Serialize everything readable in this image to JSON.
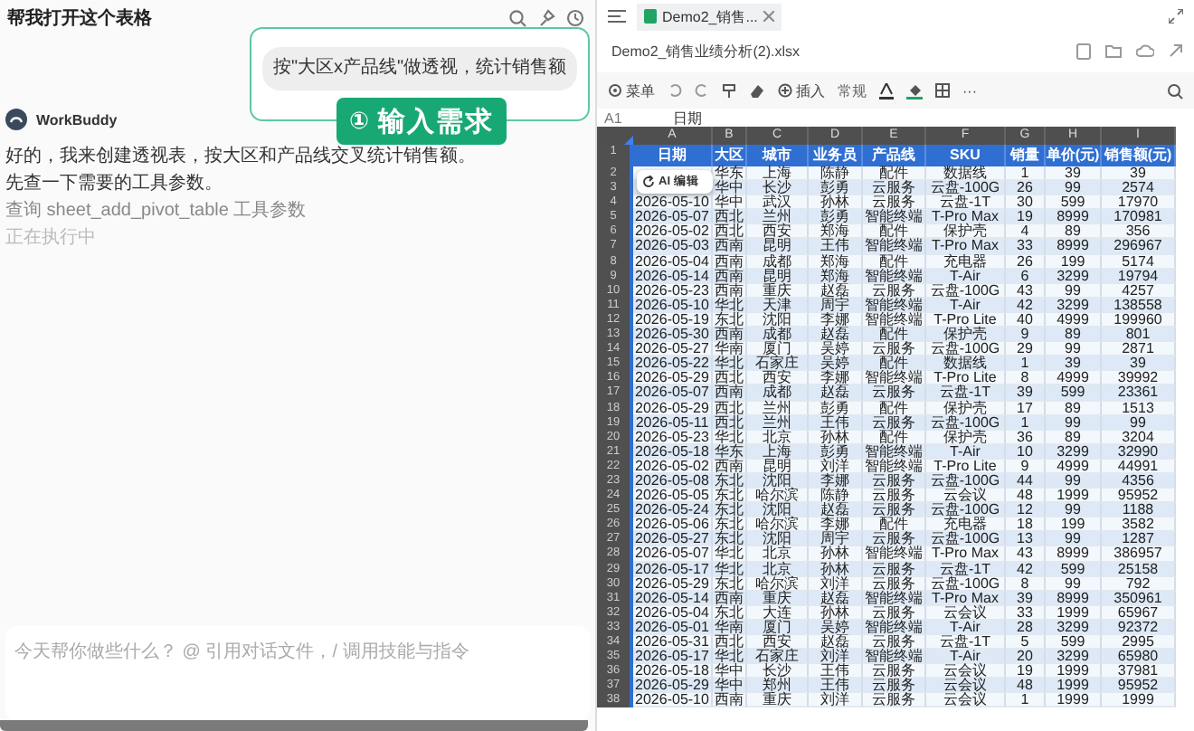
{
  "chat": {
    "title": "帮我打开这个表格",
    "callout": {
      "bubble": "按\"大区x产品线\"做透视，统计销售额",
      "badge": "①",
      "label": "输入需求"
    },
    "assistant": {
      "name": "WorkBuddy"
    },
    "messages": [
      {
        "kind": "text",
        "text": "好的，我来创建透视表，按大区和产品线交叉统计销售额。"
      },
      {
        "kind": "text",
        "text": "先查一下需要的工具参数。"
      },
      {
        "kind": "tool",
        "text": "查询 sheet_add_pivot_table 工具参数"
      },
      {
        "kind": "status",
        "text": "正在执行中"
      }
    ],
    "input": {
      "placeholder": "今天帮你做些什么？ @ 引用对话文件，/ 调用技能与指令"
    }
  },
  "spreadsheet": {
    "tab": {
      "label": "Demo2_销售...",
      "selected": true
    },
    "file_name": "Demo2_销售业绩分析(2).xlsx",
    "toolbar": {
      "menu": "菜单",
      "insert": "插入",
      "number_format": "常规",
      "more": "···"
    },
    "cell_ref": "A1",
    "formula": "日期",
    "overlay_button": "AI 编辑",
    "column_letters": [
      "A",
      "B",
      "C",
      "D",
      "E",
      "F",
      "G",
      "H",
      "I"
    ],
    "header_row": {
      "number": "1",
      "cells": [
        "日期",
        "大区",
        "城市",
        "业务员",
        "产品线",
        "SKU",
        "销量",
        "单价(元)",
        "销售额(元)"
      ]
    },
    "rows": [
      {
        "number": "2",
        "values": [
          "华东",
          "上海",
          "陈静",
          "配件",
          "数据线",
          "1",
          "39",
          "39"
        ]
      },
      {
        "number": "3",
        "values": [
          "华中",
          "长沙",
          "彭勇",
          "云服务",
          "云盘-100G",
          "26",
          "99",
          "2574"
        ]
      },
      {
        "number": "4",
        "date": "2026-05-10",
        "values": [
          "华中",
          "武汉",
          "孙林",
          "云服务",
          "云盘-1T",
          "30",
          "599",
          "17970"
        ]
      },
      {
        "number": "5",
        "date": "2026-05-07",
        "values": [
          "西北",
          "兰州",
          "彭勇",
          "智能终端",
          "T-Pro Max",
          "19",
          "8999",
          "170981"
        ]
      },
      {
        "number": "6",
        "date": "2026-05-02",
        "values": [
          "西北",
          "西安",
          "郑海",
          "配件",
          "保护壳",
          "4",
          "89",
          "356"
        ]
      },
      {
        "number": "7",
        "date": "2026-05-03",
        "values": [
          "西南",
          "昆明",
          "王伟",
          "智能终端",
          "T-Pro Max",
          "33",
          "8999",
          "296967"
        ]
      },
      {
        "number": "8",
        "date": "2026-05-04",
        "values": [
          "西南",
          "成都",
          "郑海",
          "配件",
          "充电器",
          "26",
          "199",
          "5174"
        ]
      },
      {
        "number": "9",
        "date": "2026-05-14",
        "values": [
          "西南",
          "昆明",
          "郑海",
          "智能终端",
          "T-Air",
          "6",
          "3299",
          "19794"
        ]
      },
      {
        "number": "10",
        "date": "2026-05-23",
        "values": [
          "西南",
          "重庆",
          "赵磊",
          "云服务",
          "云盘-100G",
          "43",
          "99",
          "4257"
        ]
      },
      {
        "number": "11",
        "date": "2026-05-10",
        "values": [
          "华北",
          "天津",
          "周宇",
          "智能终端",
          "T-Air",
          "42",
          "3299",
          "138558"
        ]
      },
      {
        "number": "12",
        "date": "2026-05-19",
        "values": [
          "东北",
          "沈阳",
          "李娜",
          "智能终端",
          "T-Pro Lite",
          "40",
          "4999",
          "199960"
        ]
      },
      {
        "number": "13",
        "date": "2026-05-30",
        "values": [
          "西南",
          "成都",
          "赵磊",
          "配件",
          "保护壳",
          "9",
          "89",
          "801"
        ]
      },
      {
        "number": "14",
        "date": "2026-05-27",
        "values": [
          "华南",
          "厦门",
          "吴婷",
          "云服务",
          "云盘-100G",
          "29",
          "99",
          "2871"
        ]
      },
      {
        "number": "15",
        "date": "2026-05-22",
        "values": [
          "华北",
          "石家庄",
          "吴婷",
          "配件",
          "数据线",
          "1",
          "39",
          "39"
        ]
      },
      {
        "number": "16",
        "date": "2026-05-29",
        "values": [
          "西北",
          "西安",
          "李娜",
          "智能终端",
          "T-Pro Lite",
          "8",
          "4999",
          "39992"
        ]
      },
      {
        "number": "17",
        "date": "2026-05-07",
        "values": [
          "西南",
          "成都",
          "赵磊",
          "云服务",
          "云盘-1T",
          "39",
          "599",
          "23361"
        ]
      },
      {
        "number": "18",
        "date": "2026-05-29",
        "values": [
          "西北",
          "兰州",
          "彭勇",
          "配件",
          "保护壳",
          "17",
          "89",
          "1513"
        ]
      },
      {
        "number": "19",
        "date": "2026-05-11",
        "values": [
          "西北",
          "兰州",
          "王伟",
          "云服务",
          "云盘-100G",
          "1",
          "99",
          "99"
        ]
      },
      {
        "number": "20",
        "date": "2026-05-23",
        "values": [
          "华北",
          "北京",
          "孙林",
          "配件",
          "保护壳",
          "36",
          "89",
          "3204"
        ]
      },
      {
        "number": "21",
        "date": "2026-05-18",
        "values": [
          "华东",
          "上海",
          "彭勇",
          "智能终端",
          "T-Air",
          "10",
          "3299",
          "32990"
        ]
      },
      {
        "number": "22",
        "date": "2026-05-02",
        "values": [
          "西南",
          "昆明",
          "刘洋",
          "智能终端",
          "T-Pro Lite",
          "9",
          "4999",
          "44991"
        ]
      },
      {
        "number": "23",
        "date": "2026-05-08",
        "values": [
          "东北",
          "沈阳",
          "李娜",
          "云服务",
          "云盘-100G",
          "44",
          "99",
          "4356"
        ]
      },
      {
        "number": "24",
        "date": "2026-05-05",
        "values": [
          "东北",
          "哈尔滨",
          "陈静",
          "云服务",
          "云会议",
          "48",
          "1999",
          "95952"
        ]
      },
      {
        "number": "25",
        "date": "2026-05-24",
        "values": [
          "东北",
          "沈阳",
          "赵磊",
          "云服务",
          "云盘-100G",
          "12",
          "99",
          "1188"
        ]
      },
      {
        "number": "26",
        "date": "2026-05-06",
        "values": [
          "东北",
          "哈尔滨",
          "李娜",
          "配件",
          "充电器",
          "18",
          "199",
          "3582"
        ]
      },
      {
        "number": "27",
        "date": "2026-05-27",
        "values": [
          "东北",
          "沈阳",
          "周宇",
          "云服务",
          "云盘-100G",
          "13",
          "99",
          "1287"
        ]
      },
      {
        "number": "28",
        "date": "2026-05-07",
        "values": [
          "华北",
          "北京",
          "孙林",
          "智能终端",
          "T-Pro Max",
          "43",
          "8999",
          "386957"
        ]
      },
      {
        "number": "29",
        "date": "2026-05-17",
        "values": [
          "华北",
          "北京",
          "孙林",
          "云服务",
          "云盘-1T",
          "42",
          "599",
          "25158"
        ]
      },
      {
        "number": "30",
        "date": "2026-05-29",
        "values": [
          "东北",
          "哈尔滨",
          "刘洋",
          "云服务",
          "云盘-100G",
          "8",
          "99",
          "792"
        ]
      },
      {
        "number": "31",
        "date": "2026-05-14",
        "values": [
          "西南",
          "重庆",
          "赵磊",
          "智能终端",
          "T-Pro Max",
          "39",
          "8999",
          "350961"
        ]
      },
      {
        "number": "32",
        "date": "2026-05-04",
        "values": [
          "东北",
          "大连",
          "孙林",
          "云服务",
          "云会议",
          "33",
          "1999",
          "65967"
        ]
      },
      {
        "number": "33",
        "date": "2026-05-01",
        "values": [
          "华南",
          "厦门",
          "吴婷",
          "智能终端",
          "T-Air",
          "28",
          "3299",
          "92372"
        ]
      },
      {
        "number": "34",
        "date": "2026-05-31",
        "values": [
          "西北",
          "西安",
          "赵磊",
          "云服务",
          "云盘-1T",
          "5",
          "599",
          "2995"
        ]
      },
      {
        "number": "35",
        "date": "2026-05-17",
        "values": [
          "华北",
          "石家庄",
          "刘洋",
          "智能终端",
          "T-Air",
          "20",
          "3299",
          "65980"
        ]
      },
      {
        "number": "36",
        "date": "2026-05-18",
        "values": [
          "华中",
          "长沙",
          "王伟",
          "云服务",
          "云会议",
          "19",
          "1999",
          "37981"
        ]
      },
      {
        "number": "37",
        "date": "2026-05-29",
        "values": [
          "华中",
          "郑州",
          "王伟",
          "云服务",
          "云会议",
          "48",
          "1999",
          "95952"
        ]
      },
      {
        "number": "38",
        "date": "2026-05-10",
        "values": [
          "西南",
          "重庆",
          "刘洋",
          "云服务",
          "云会议",
          "1",
          "1999",
          "1999"
        ]
      }
    ]
  }
}
